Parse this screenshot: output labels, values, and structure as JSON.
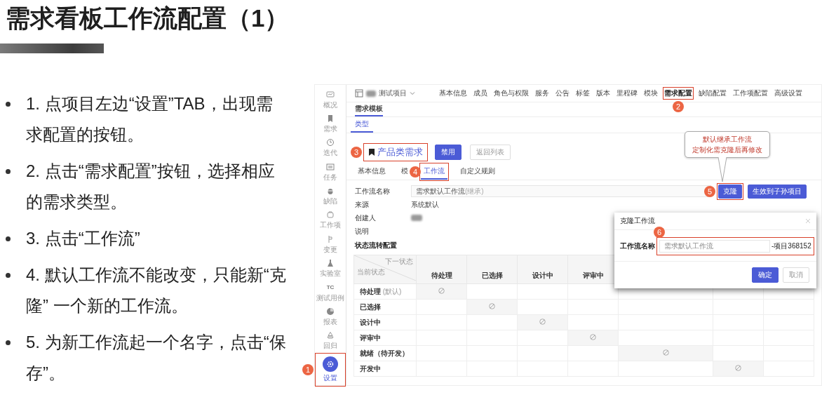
{
  "slide": {
    "title": "需求看板工作流配置（1）",
    "bullets": [
      "1. 点项目左边“设置”TAB，出现需求配置的按钮。",
      "2. 点击“需求配置”按钮，选择相应的需求类型。",
      "3. 点击“工作流”",
      "4. 默认工作流不能改变，只能新“克隆” 一个新的工作流。",
      "5. 为新工作流起一个名字，点击“保存”。"
    ]
  },
  "app": {
    "sidebar": {
      "items": [
        {
          "label": "概况",
          "selected": false
        },
        {
          "label": "需求",
          "selected": false
        },
        {
          "label": "迭代",
          "selected": false
        },
        {
          "label": "任务",
          "selected": false
        },
        {
          "label": "缺陷",
          "selected": false
        },
        {
          "label": "工作项",
          "selected": false
        },
        {
          "label": "变更",
          "selected": false
        },
        {
          "label": "实验室",
          "selected": false
        },
        {
          "label": "测试用例",
          "icon_text": "TC",
          "selected": false
        },
        {
          "label": "报表",
          "selected": false
        },
        {
          "label": "回归",
          "selected": false
        },
        {
          "label": "设置",
          "selected": true,
          "badge": "1"
        }
      ]
    },
    "project": {
      "name": "测试项目"
    },
    "nav": [
      {
        "label": "基本信息",
        "selected": false
      },
      {
        "label": "成员",
        "selected": false
      },
      {
        "label": "角色与权限",
        "selected": false
      },
      {
        "label": "服务",
        "selected": false
      },
      {
        "label": "公告",
        "selected": false
      },
      {
        "label": "标签",
        "selected": false
      },
      {
        "label": "版本",
        "selected": false
      },
      {
        "label": "里程碑",
        "selected": false
      },
      {
        "label": "模块",
        "selected": false
      },
      {
        "label": "需求配置",
        "selected": true,
        "badge": "2"
      },
      {
        "label": "缺陷配置",
        "selected": false
      },
      {
        "label": "工作项配置",
        "selected": false
      },
      {
        "label": "高级设置",
        "selected": false
      }
    ],
    "template_tabs": [
      {
        "label": "需求模板",
        "selected": true
      }
    ],
    "type_tabs": [
      {
        "label": "类型",
        "selected": true
      }
    ],
    "type_header": {
      "title": "产品类需求",
      "badge": "3",
      "buttons": [
        {
          "label": "禁用",
          "kind": "primary"
        },
        {
          "label": "返回列表",
          "kind": "plain"
        }
      ]
    },
    "detail_tabs": [
      {
        "label": "基本信息",
        "selected": false
      },
      {
        "label": "模",
        "selected": false
      },
      {
        "label": "工作流",
        "selected": true,
        "badge": "4"
      },
      {
        "label": "自定义规则",
        "selected": false
      }
    ],
    "form": {
      "rows": [
        {
          "kind": "field",
          "label": "工作流名称",
          "value": "需求默认工作流",
          "suffix": "(继承)"
        },
        {
          "kind": "text",
          "label": "来源",
          "value": "系统默认"
        },
        {
          "kind": "redacted",
          "label": "创建人"
        },
        {
          "kind": "text",
          "label": "说明"
        }
      ],
      "buttons": [
        {
          "label": "克隆",
          "badge": "5"
        },
        {
          "label": "生效到子孙项目"
        }
      ]
    },
    "section_title": "状态流转配置",
    "table": {
      "corner": {
        "next": "下一状态",
        "current": "当前状态"
      },
      "columns": [
        "待处理",
        "已选择",
        "设计中",
        "评审中"
      ],
      "rows": [
        {
          "label": "待处理",
          "note": "(默认)",
          "cells": [
            {
              "blocked": true
            },
            {
              "blocked": false
            },
            {
              "blocked": false
            },
            {
              "blocked": false
            },
            {
              "blocked": false
            },
            {
              "blocked": false
            },
            {
              "blocked": false
            }
          ]
        },
        {
          "label": "已选择",
          "cells": [
            {
              "blocked": false
            },
            {
              "blocked": true
            },
            {
              "blocked": false
            },
            {
              "blocked": false
            },
            {
              "blocked": false
            },
            {
              "blocked": false
            },
            {
              "blocked": false
            }
          ]
        },
        {
          "label": "设计中",
          "cells": [
            {
              "blocked": false
            },
            {
              "blocked": false
            },
            {
              "blocked": true
            },
            {
              "blocked": false
            },
            {
              "blocked": false
            },
            {
              "blocked": false
            },
            {
              "blocked": false
            }
          ]
        },
        {
          "label": "评审中",
          "cells": [
            {
              "blocked": false
            },
            {
              "blocked": false
            },
            {
              "blocked": false
            },
            {
              "blocked": true
            },
            {
              "blocked": false
            },
            {
              "blocked": false
            },
            {
              "blocked": false
            }
          ]
        },
        {
          "label": "就绪（待开发）",
          "cells": [
            {
              "blocked": false
            },
            {
              "blocked": false
            },
            {
              "blocked": false
            },
            {
              "blocked": false
            },
            {
              "blocked": true
            },
            {
              "blocked": false
            },
            {
              "blocked": false
            }
          ]
        },
        {
          "label": "开发中",
          "cells": [
            {
              "blocked": false
            },
            {
              "blocked": false
            },
            {
              "blocked": false
            },
            {
              "blocked": false
            },
            {
              "blocked": false
            },
            {
              "blocked": true
            },
            {
              "blocked": false
            }
          ]
        }
      ]
    },
    "callout": {
      "lines": [
        "默认继承工作流",
        "定制化需克隆后再修改"
      ]
    },
    "modal": {
      "title": "克隆工作流",
      "field_label": "工作流名称",
      "field_value": "需求默认工作流",
      "suffix": "-项目368152",
      "badge": "6",
      "buttons": [
        {
          "label": "确定",
          "kind": "primary"
        },
        {
          "label": "取消",
          "kind": "plain"
        }
      ]
    }
  }
}
